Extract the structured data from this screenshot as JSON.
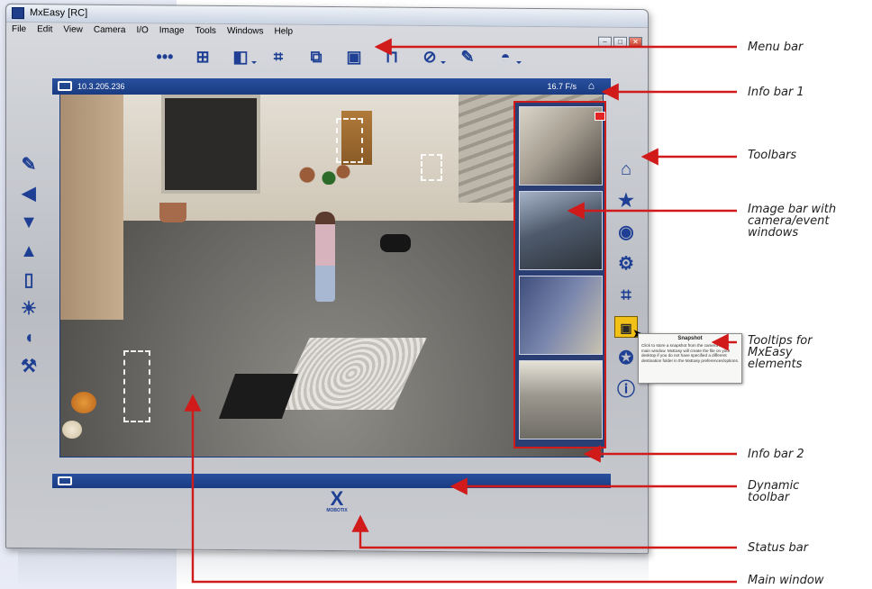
{
  "window": {
    "title": "MxEasy [RC]",
    "controls": [
      "–",
      "□",
      "✕"
    ]
  },
  "menu": {
    "items": [
      "File",
      "Edit",
      "View",
      "Camera",
      "I/O",
      "Image",
      "Tools",
      "Windows",
      "Help"
    ]
  },
  "top_toolbar": {
    "icons": [
      "more-dots",
      "layout-grid",
      "split-view",
      "fullscreen-frame",
      "resize-frame",
      "record-tape",
      "unlock",
      "alarm-off",
      "tools",
      "siren"
    ]
  },
  "left_toolbar": {
    "icons": [
      "microphone",
      "speaker",
      "volume-down",
      "volume-up",
      "door",
      "light",
      "announce",
      "wrench"
    ]
  },
  "info_bar_1": {
    "ip": "10.3.205.236",
    "fps": "16.7 F/s"
  },
  "right_toolbar": {
    "icons": [
      "home",
      "favorites",
      "event-target",
      "settings-gear",
      "crop",
      "snapshot",
      "lifebuoy",
      "info"
    ]
  },
  "tooltip": {
    "title": "Snapshot",
    "body": "Click to store a snapshot from the camera in the main window. MxEasy will create the file on your desktop if you do not have specified a different destination folder in the MxEasy preferences/options."
  },
  "logo": {
    "mark": "X",
    "text": "MOBOTIX"
  },
  "callouts": [
    "Menu bar",
    "Info bar 1",
    "Toolbars",
    "Image bar with camera/event windows",
    "Tooltips for MxEasy elements",
    "Info bar 2",
    "Dynamic toolbar",
    "Status bar",
    "Main window"
  ],
  "colors": {
    "accent": "#1e3f93",
    "arrow": "#d11a1a",
    "info_bar": "#1a3b82",
    "snapshot_active": "#f2c117"
  }
}
